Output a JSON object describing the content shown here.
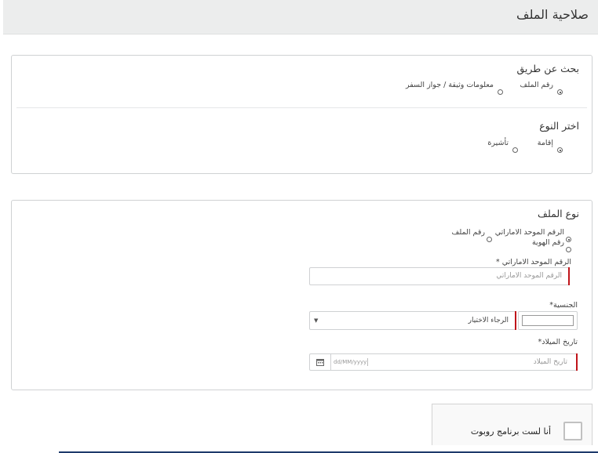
{
  "page": {
    "title": "صلاحية الملف"
  },
  "search_panel": {
    "heading": "بحث عن طريق",
    "options": [
      "رقم الملف",
      "معلومات وثيقة / جواز السفر"
    ],
    "selected": 0
  },
  "type_panel": {
    "heading": "اختر النوع",
    "options": [
      "إقامة",
      "تأشيرة"
    ],
    "selected": 0
  },
  "file_type_panel": {
    "heading": "نوع الملف",
    "options": [
      "الرقم الموحد الاماراتي",
      "رقم الملف",
      "رقم الهوية"
    ],
    "selected": 0,
    "uid_label": "الرقم الموحد الاماراتي *",
    "uid_placeholder": "الرقم الموحد الاماراتي",
    "nationality_label": "الجنسية*",
    "nationality_select": "الرجاء الاختيار",
    "dob_label": "تاريخ الميلاد*",
    "dob_placeholder": "تاريخ الميلاد",
    "dob_format": "dd/MM/yyyy"
  },
  "captcha": {
    "label": "أنا لست برنامج روبوت"
  },
  "colors": {
    "accent_red": "#c0141a",
    "header_bg": "#eceded",
    "border": "#cfd1d3"
  }
}
